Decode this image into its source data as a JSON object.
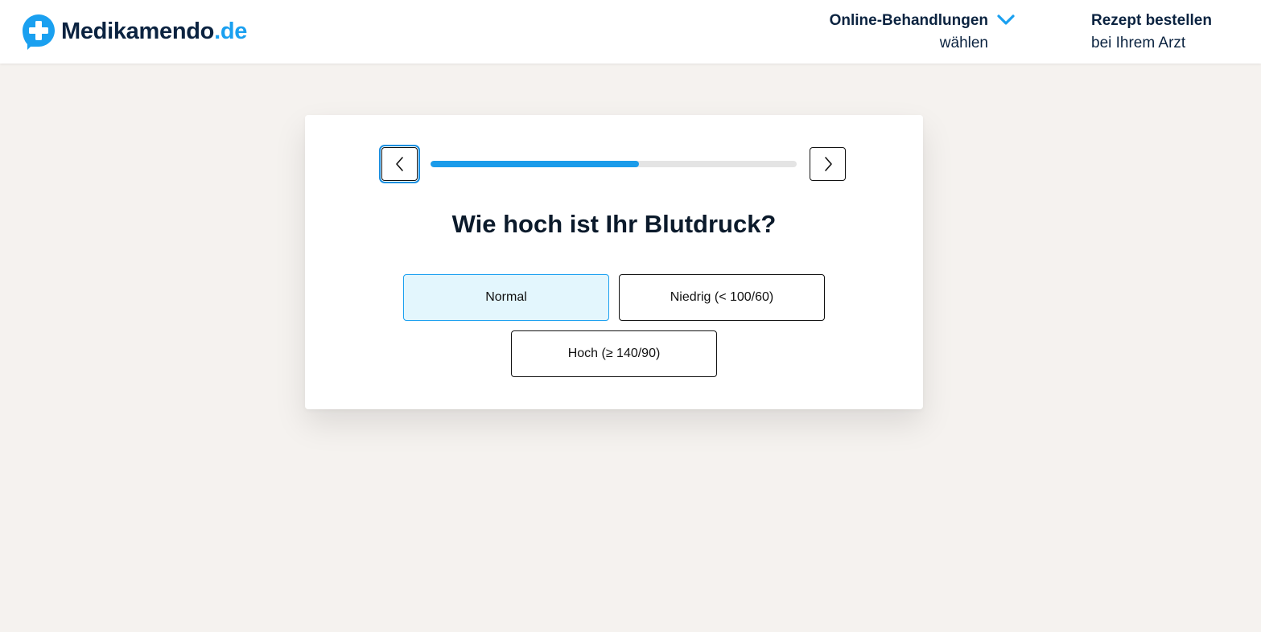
{
  "header": {
    "logo": {
      "name": "Medikamendo",
      "tld": ".de",
      "brand_color": "#1aa0f0"
    },
    "nav": [
      {
        "line1": "Online-Behandlungen",
        "line2": "wählen",
        "icon": "chevron-down-icon"
      },
      {
        "line1": "Rezept bestellen",
        "line2": "bei Ihrem Arzt"
      }
    ]
  },
  "questionnaire": {
    "progress": 0.57,
    "back_icon": "chevron-left-icon",
    "next_icon": "chevron-right-icon",
    "question": "Wie hoch ist Ihr Blutdruck?",
    "options": [
      {
        "label": "Normal",
        "selected": true
      },
      {
        "label": "Niedrig (< 100/60)",
        "selected": false
      },
      {
        "label": "Hoch (≥ 140/90)",
        "selected": false
      }
    ]
  },
  "colors": {
    "accent": "#1a9bea",
    "selected_bg": "#e3f6fd",
    "page_bg": "#f5f2ef",
    "text_dark": "#0b2340"
  }
}
